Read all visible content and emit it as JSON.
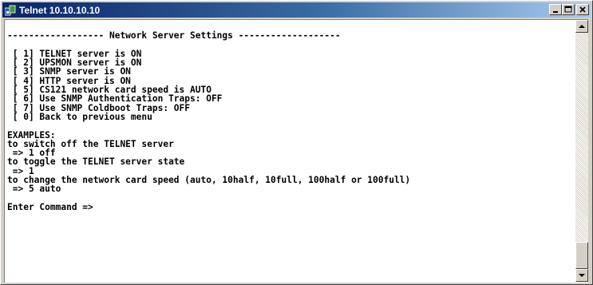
{
  "window": {
    "title": "Telnet 10.10.10.10"
  },
  "terminal": {
    "lines": [
      "",
      "------------------ Network Server Settings -------------------",
      "",
      " [ 1] TELNET server is ON",
      " [ 2] UPSMON server is ON",
      " [ 3] SNMP server is ON",
      " [ 4] HTTP server is ON",
      " [ 5] CS121 network card speed is AUTO",
      " [ 6] Use SNMP Authentication Traps: OFF",
      " [ 7] Use SNMP Coldboot Traps: OFF",
      " [ 0] Back to previous menu",
      "",
      "EXAMPLES:",
      "to switch off the TELNET server",
      " => 1 off",
      "to toggle the TELNET server state",
      " => 1",
      "to change the network card speed (auto, 10half, 10full, 100half or 100full)",
      " => 5 auto",
      "",
      "Enter Command =>"
    ]
  },
  "icons": {
    "app": "telnet-icon",
    "minimize": "minimize-icon",
    "maximize": "maximize-icon",
    "close": "close-icon",
    "scroll_up": "arrow-up-icon",
    "scroll_down": "arrow-down-icon"
  }
}
